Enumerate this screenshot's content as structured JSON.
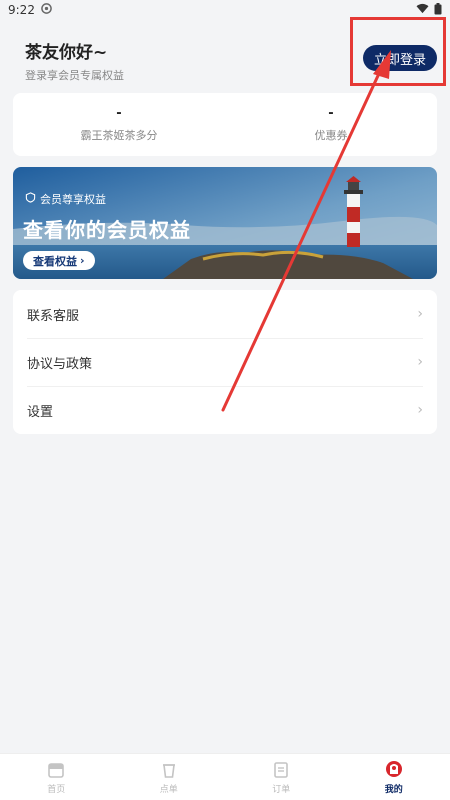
{
  "status_bar": {
    "time": "9:22"
  },
  "header": {
    "greeting": "茶友你好~",
    "subtitle": "登录享会员专属权益"
  },
  "login_button": {
    "label": "立即登录"
  },
  "stats": [
    {
      "value": "-",
      "label": "霸王茶姬茶多分"
    },
    {
      "value": "-",
      "label": "优惠券"
    }
  ],
  "banner": {
    "tag": "会员尊享权益",
    "title": "查看你的会员权益",
    "button": "查看权益"
  },
  "menu": [
    {
      "label": "联系客服"
    },
    {
      "label": "协议与政策"
    },
    {
      "label": "设置"
    }
  ],
  "tabs": [
    {
      "label": "首页"
    },
    {
      "label": "点单"
    },
    {
      "label": "订单"
    },
    {
      "label": "我的"
    }
  ],
  "colors": {
    "accent": "#0e2a66",
    "highlight": "#e53935"
  }
}
